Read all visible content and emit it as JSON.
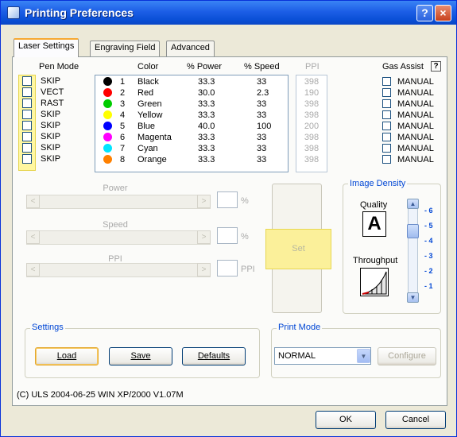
{
  "window": {
    "title": "Printing Preferences",
    "help_label": "?",
    "close_label": "×"
  },
  "tabs": [
    {
      "label": "Laser Settings"
    },
    {
      "label": "Engraving Field"
    },
    {
      "label": "Advanced"
    }
  ],
  "table": {
    "headers": {
      "pen_mode": "Pen Mode",
      "color": "Color",
      "power": "% Power",
      "speed": "% Speed",
      "ppi": "PPI",
      "gas_assist": "Gas Assist",
      "help": "?"
    },
    "rows": [
      {
        "mode": "SKIP",
        "dot": "#000000",
        "num": "1",
        "color": "Black",
        "power": "33.3",
        "speed": "33",
        "ppi": "398",
        "gas": "MANUAL"
      },
      {
        "mode": "VECT",
        "dot": "#ff0000",
        "num": "2",
        "color": "Red",
        "power": "30.0",
        "speed": "2.3",
        "ppi": "190",
        "gas": "MANUAL"
      },
      {
        "mode": "RAST",
        "dot": "#00cc00",
        "num": "3",
        "color": "Green",
        "power": "33.3",
        "speed": "33",
        "ppi": "398",
        "gas": "MANUAL"
      },
      {
        "mode": "SKIP",
        "dot": "#ffff00",
        "num": "4",
        "color": "Yellow",
        "power": "33.3",
        "speed": "33",
        "ppi": "398",
        "gas": "MANUAL"
      },
      {
        "mode": "SKIP",
        "dot": "#0000ff",
        "num": "5",
        "color": "Blue",
        "power": "40.0",
        "speed": "100",
        "ppi": "200",
        "gas": "MANUAL"
      },
      {
        "mode": "SKIP",
        "dot": "#ff00ff",
        "num": "6",
        "color": "Magenta",
        "power": "33.3",
        "speed": "33",
        "ppi": "398",
        "gas": "MANUAL"
      },
      {
        "mode": "SKIP",
        "dot": "#00e5ff",
        "num": "7",
        "color": "Cyan",
        "power": "33.3",
        "speed": "33",
        "ppi": "398",
        "gas": "MANUAL"
      },
      {
        "mode": "SKIP",
        "dot": "#ff8000",
        "num": "8",
        "color": "Orange",
        "power": "33.3",
        "speed": "33",
        "ppi": "398",
        "gas": "MANUAL"
      }
    ]
  },
  "sliders": {
    "power": {
      "label": "Power",
      "unit": "%"
    },
    "speed": {
      "label": "Speed",
      "unit": "%"
    },
    "ppi": {
      "label": "PPI",
      "unit": "PPI"
    }
  },
  "set_button": {
    "label": "Set"
  },
  "image_density": {
    "title": "Image Density",
    "quality_label": "Quality",
    "throughput_label": "Throughput",
    "ticks": [
      "6",
      "5",
      "4",
      "3",
      "2",
      "1"
    ],
    "selected": 5
  },
  "settings": {
    "title": "Settings",
    "load": "Load",
    "save": "Save",
    "defaults": "Defaults"
  },
  "print_mode": {
    "title": "Print Mode",
    "selected": "NORMAL",
    "configure": "Configure"
  },
  "footer": {
    "version": "(C) ULS 2004-06-25 WIN XP/2000 V1.07M",
    "ok": "OK",
    "cancel": "Cancel"
  }
}
